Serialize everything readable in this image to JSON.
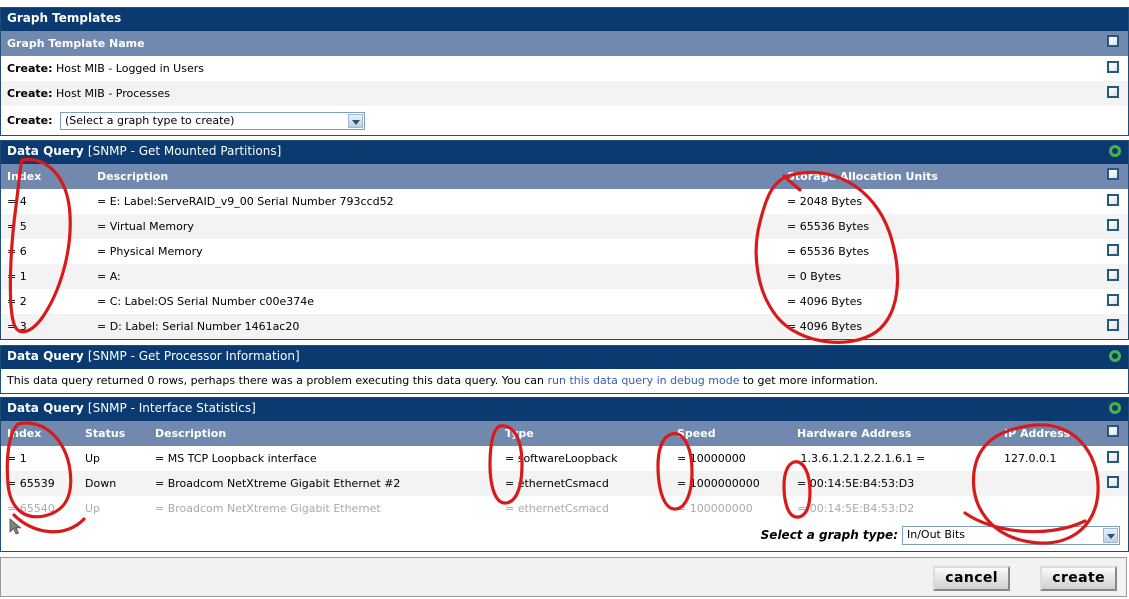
{
  "colors": {
    "bar": "#0a3a70",
    "colhead": "#7189ae",
    "link": "#3f5ba8",
    "green_icon": "#46b446",
    "annotation": "#d81a1a"
  },
  "graph_templates": {
    "title": "Graph Templates",
    "column_header": "Graph Template Name",
    "rows": [
      {
        "prefix": "Create:",
        "name": "Host MIB - Logged in Users"
      },
      {
        "prefix": "Create:",
        "name": "Host MIB - Processes"
      }
    ],
    "create_row": {
      "prefix": "Create:",
      "select_value": "(Select a graph type to create)"
    }
  },
  "data_queries": [
    {
      "title_label": "Data Query",
      "title_name": "[SNMP - Get Mounted Partitions]",
      "has_rows": true,
      "columns": [
        "Index",
        "Description",
        "Storage Allocation Units"
      ],
      "rows": [
        {
          "index": "= 4",
          "description": "= E: Label:ServeRAID_v9_00 Serial Number 793ccd52",
          "units": "= 2048 Bytes",
          "checkbox": true,
          "disabled": false
        },
        {
          "index": "= 5",
          "description": "= Virtual Memory",
          "units": "= 65536 Bytes",
          "checkbox": true,
          "disabled": false
        },
        {
          "index": "= 6",
          "description": "= Physical Memory",
          "units": "= 65536 Bytes",
          "checkbox": true,
          "disabled": false
        },
        {
          "index": "= 1",
          "description": "= A:",
          "units": "= 0 Bytes",
          "checkbox": true,
          "disabled": false
        },
        {
          "index": "= 2",
          "description": "= C: Label:OS Serial Number c00e374e",
          "units": "= 4096 Bytes",
          "checkbox": true,
          "disabled": false
        },
        {
          "index": "= 3",
          "description": "= D: Label: Serial Number 1461ac20",
          "units": "= 4096 Bytes",
          "checkbox": true,
          "disabled": false
        }
      ]
    },
    {
      "title_label": "Data Query",
      "title_name": "[SNMP - Get Processor Information]",
      "has_rows": false,
      "message_before": "This data query returned 0 rows, perhaps there was a problem executing this data query. You can ",
      "message_link": "run this data query in debug mode",
      "message_after": " to get more information."
    },
    {
      "title_label": "Data Query",
      "title_name": "[SNMP - Interface Statistics]",
      "has_rows": true,
      "columns": [
        "Index",
        "Status",
        "Description",
        "Type",
        "Speed",
        "Hardware Address",
        "IP Address"
      ],
      "rows": [
        {
          "index": "= 1",
          "status": "Up",
          "description": "= MS TCP Loopback interface",
          "type": "= softwareLoopback",
          "speed": "= 10000000",
          "hardware_address": ".1.3.6.1.2.1.2.2.1.6.1 =",
          "ip_address": "127.0.0.1",
          "checkbox": true,
          "disabled": false
        },
        {
          "index": "= 65539",
          "status": "Down",
          "description": "= Broadcom NetXtreme Gigabit Ethernet #2",
          "type": "= ethernetCsmacd",
          "speed": "= 1000000000",
          "hardware_address": "= 00:14:5E:B4:53:D3",
          "ip_address": "",
          "checkbox": true,
          "disabled": false
        },
        {
          "index": "= 65540",
          "status": "Up",
          "description": "= Broadcom NetXtreme Gigabit Ethernet",
          "type": "= ethernetCsmacd",
          "speed": "= 100000000",
          "hardware_address": "= 00:14:5E:B4:53:D2",
          "ip_address": "",
          "checkbox": false,
          "disabled": true
        }
      ],
      "footer": {
        "label": "Select a graph type:",
        "select_value": "In/Out Bits"
      }
    }
  ],
  "buttons": {
    "cancel": "cancel",
    "create": "create"
  },
  "icons": {
    "green_ring": "green-ring-icon",
    "dropdown_arrow": "chevron-down-icon",
    "cursor": "mouse-cursor"
  }
}
